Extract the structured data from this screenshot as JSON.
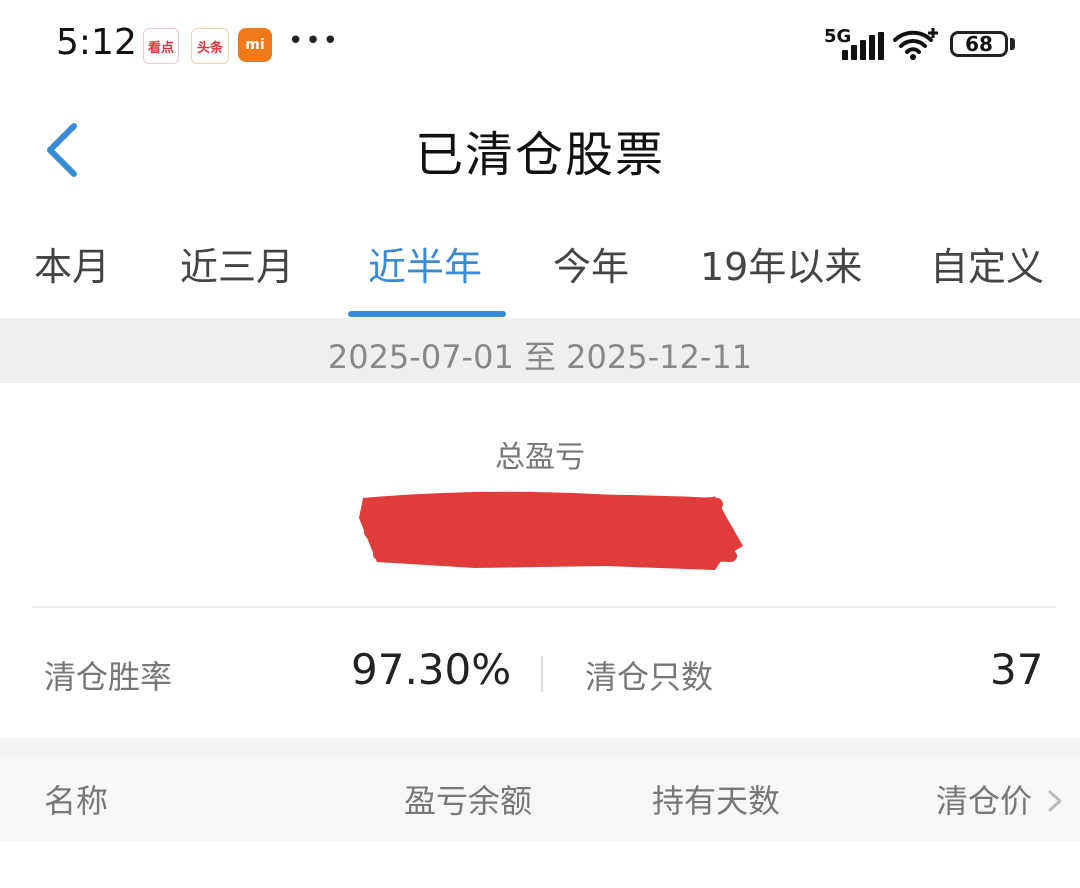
{
  "status_bar": {
    "time": "5:12",
    "apps": [
      {
        "name": "kandian-app-icon",
        "label": "看点"
      },
      {
        "name": "toutiao-app-icon",
        "label": "头条"
      },
      {
        "name": "mi-app-icon",
        "label": "mi"
      }
    ],
    "more": "•••",
    "network": "5G",
    "battery": "68"
  },
  "nav": {
    "title": "已清仓股票",
    "back_icon": "chevron-left-icon"
  },
  "tabs": [
    {
      "label": "本月",
      "active": false
    },
    {
      "label": "近三月",
      "active": false
    },
    {
      "label": "近半年",
      "active": true
    },
    {
      "label": "今年",
      "active": false
    },
    {
      "label": "19年以来",
      "active": false
    },
    {
      "label": "自定义",
      "active": false
    }
  ],
  "date_range": "2025-07-01 至 2025-12-11",
  "summary": {
    "total_label": "总盈亏",
    "win_rate_label": "清仓胜率",
    "win_rate_value": "97.30%",
    "count_label": "清仓只数",
    "count_value": "37"
  },
  "table": {
    "columns": [
      "名称",
      "盈亏余额",
      "持有天数",
      "清仓价"
    ]
  },
  "colors": {
    "accent": "#3a8bd6",
    "redaction": "#e03c3c"
  }
}
